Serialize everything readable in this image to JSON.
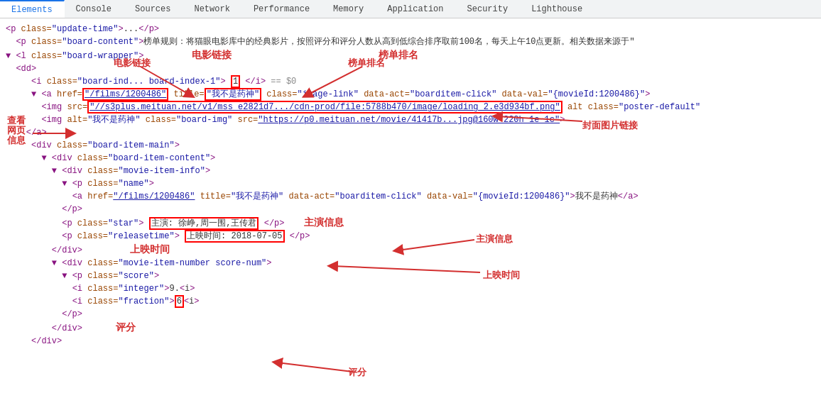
{
  "tabs": [
    {
      "label": "Elements",
      "active": true
    },
    {
      "label": "Console",
      "active": false
    },
    {
      "label": "Sources",
      "active": false
    },
    {
      "label": "Network",
      "active": false
    },
    {
      "label": "Performance",
      "active": false
    },
    {
      "label": "Memory",
      "active": false
    },
    {
      "label": "Application",
      "active": false
    },
    {
      "label": "Security",
      "active": false
    },
    {
      "label": "Lighthouse",
      "active": false
    }
  ],
  "annotations": {
    "movie_link": "电影链接",
    "rank": "榜单排名",
    "cover_link": "封面图片链接",
    "actor_info": "主演信息",
    "release_time": "上映时间",
    "rating": "评分",
    "view_page": "查看\n网页\n信息"
  }
}
